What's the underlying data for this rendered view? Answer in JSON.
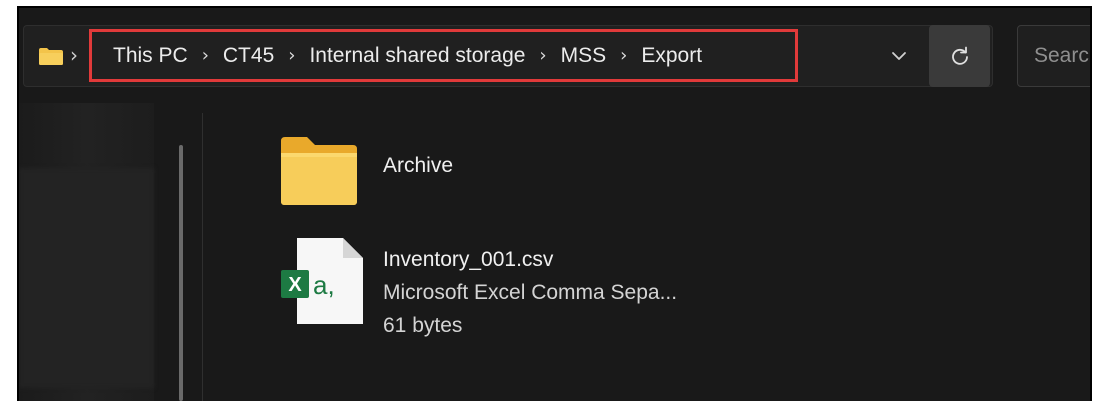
{
  "breadcrumb": {
    "items": [
      "This PC",
      "CT45",
      "Internal shared storage",
      "MSS",
      "Export"
    ],
    "separator": "›"
  },
  "search": {
    "placeholder": "Search"
  },
  "files": [
    {
      "name": "Archive",
      "type_icon": "folder-icon"
    },
    {
      "name": "Inventory_001.csv",
      "type": "Microsoft Excel Comma Sepa...",
      "size": "61 bytes",
      "type_icon": "excel-csv-icon"
    }
  ],
  "colors": {
    "highlight": "#e13a3a",
    "background": "#191919",
    "folder": "#f3c44a",
    "excel": "#1d7a43"
  }
}
